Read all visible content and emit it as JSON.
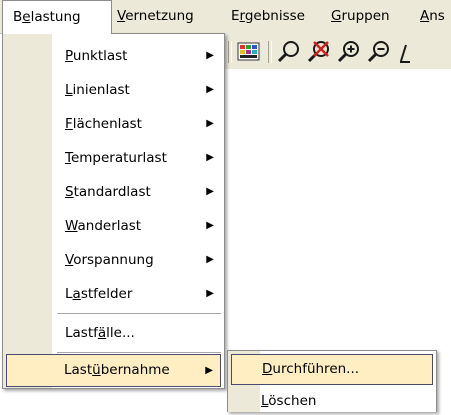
{
  "menubar": [
    {
      "pre": "B",
      "u": "e",
      "post": "lastung",
      "active": true
    },
    {
      "pre": "",
      "u": "V",
      "post": "ernetzung",
      "active": false
    },
    {
      "pre": "E",
      "u": "r",
      "post": "gebnisse",
      "active": false
    },
    {
      "pre": "",
      "u": "G",
      "post": "ruppen",
      "active": false
    },
    {
      "pre": "",
      "u": "A",
      "post": "ns",
      "active": false
    }
  ],
  "toolbar_icons": [
    "color-palette-icon",
    "zoom-icon",
    "zoom-disabled-icon",
    "zoom-in-icon",
    "zoom-out-icon"
  ],
  "belastung_menu": [
    {
      "pre": "",
      "u": "P",
      "post": "unktlast",
      "submenu": true
    },
    {
      "pre": "",
      "u": "L",
      "post": "inienlast",
      "submenu": true
    },
    {
      "pre": "",
      "u": "F",
      "post": "lächenlast",
      "submenu": true
    },
    {
      "pre": "",
      "u": "T",
      "post": "emperaturlast",
      "submenu": true
    },
    {
      "pre": "",
      "u": "S",
      "post": "tandardlast",
      "submenu": true
    },
    {
      "pre": "",
      "u": "W",
      "post": "anderlast",
      "submenu": true
    },
    {
      "pre": "",
      "u": "V",
      "post": "orspannung",
      "submenu": true
    },
    {
      "pre": "L",
      "u": "a",
      "post": "stfelder",
      "submenu": true
    },
    {
      "pre": "Lastf",
      "u": "ä",
      "post": "lle...",
      "submenu": false
    },
    {
      "pre": "Last",
      "u": "ü",
      "post": "bernahme",
      "submenu": true,
      "selected": true
    }
  ],
  "lastuebernahme_submenu": [
    {
      "pre": "",
      "u": "D",
      "post": "urchführen...",
      "selected": true
    },
    {
      "pre": "",
      "u": "L",
      "post": "öschen",
      "selected": false
    }
  ],
  "arrow_glyph": "▶"
}
